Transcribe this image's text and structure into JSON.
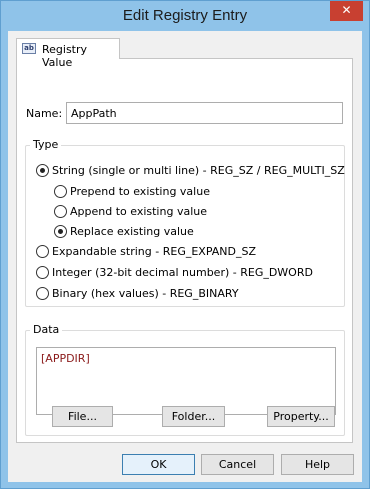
{
  "window": {
    "title": "Edit Registry Entry",
    "close_glyph": "✕"
  },
  "tab": {
    "icon_text": "ab",
    "label": "Registry Value"
  },
  "name": {
    "label": "Name:",
    "value": "AppPath"
  },
  "type_group": {
    "legend": "Type",
    "options": [
      {
        "label": "String (single or multi line) - REG_SZ / REG_MULTI_SZ",
        "checked": true
      },
      {
        "label": "Prepend to existing value",
        "checked": false
      },
      {
        "label": "Append to existing value",
        "checked": false
      },
      {
        "label": "Replace existing value",
        "checked": true
      },
      {
        "label": "Expandable string - REG_EXPAND_SZ",
        "checked": false
      },
      {
        "label": "Integer (32-bit decimal number) - REG_DWORD",
        "checked": false
      },
      {
        "label": "Binary (hex values) - REG_BINARY",
        "checked": false
      }
    ]
  },
  "data_group": {
    "legend": "Data",
    "value": "[APPDIR]",
    "buttons": {
      "file": "File...",
      "folder": "Folder...",
      "property": "Property..."
    }
  },
  "footer": {
    "ok": "OK",
    "cancel": "Cancel",
    "help": "Help"
  },
  "colors": {
    "titlebar": "#8fc3e9",
    "close": "#c84031",
    "data_text": "#8b1a1a"
  }
}
